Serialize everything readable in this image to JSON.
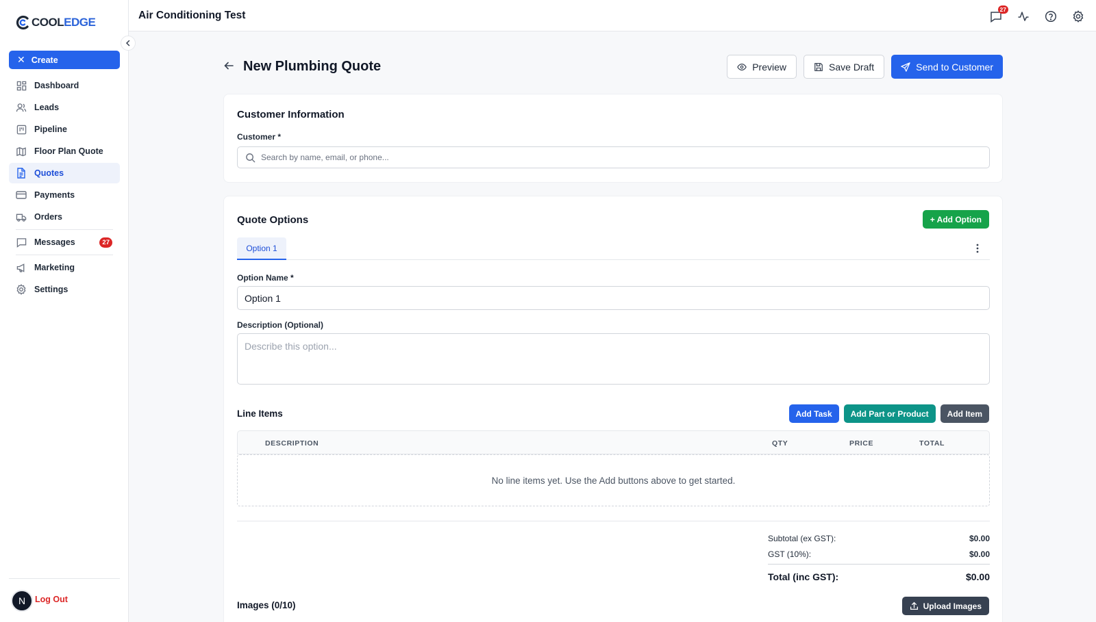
{
  "brand": {
    "name_part1": "COOL",
    "name_part2": "EDGE",
    "accent": "#2563eb"
  },
  "topbar": {
    "title": "Air Conditioning Test",
    "messages_badge": "27",
    "icons": [
      "chat-icon",
      "activity-icon",
      "help-icon",
      "gear-icon"
    ]
  },
  "sidebar": {
    "create_label": "Create",
    "items": [
      {
        "label": "Dashboard",
        "icon": "grid-icon"
      },
      {
        "label": "Leads",
        "icon": "users-icon"
      },
      {
        "label": "Pipeline",
        "icon": "kanban-icon"
      },
      {
        "label": "Floor Plan Quote",
        "icon": "map-icon"
      },
      {
        "label": "Quotes",
        "icon": "file-icon",
        "active": true
      },
      {
        "label": "Payments",
        "icon": "card-icon"
      },
      {
        "label": "Orders",
        "icon": "truck-icon"
      },
      {
        "label": "Messages",
        "icon": "message-icon",
        "badge": "27"
      },
      {
        "label": "Marketing",
        "icon": "megaphone-icon"
      },
      {
        "label": "Settings",
        "icon": "settings-icon"
      }
    ],
    "avatar_initial": "N",
    "logout_label": "Log Out"
  },
  "page": {
    "title": "New Plumbing Quote",
    "preview_label": "Preview",
    "save_draft_label": "Save Draft",
    "send_label": "Send to Customer"
  },
  "customer": {
    "section_title": "Customer Information",
    "field_label": "Customer *",
    "search_placeholder": "Search by name, email, or phone..."
  },
  "options": {
    "section_title": "Quote Options",
    "add_option_label": "+ Add Option",
    "tabs": [
      {
        "label": "Option 1"
      }
    ],
    "option_name_label": "Option Name",
    "option_name_required": "*",
    "option_name_value": "Option 1",
    "description_label": "Description (Optional)",
    "description_placeholder": "Describe this option..."
  },
  "line_items": {
    "title": "Line Items",
    "add_task_label": "Add Task",
    "add_part_label": "Add Part or Product",
    "add_item_label": "Add Item",
    "columns": [
      "DESCRIPTION",
      "QTY",
      "PRICE",
      "TOTAL"
    ],
    "empty_message": "No line items yet. Use the Add buttons above to get started."
  },
  "totals": {
    "subtotal_label": "Subtotal (ex GST):",
    "subtotal_value": "$0.00",
    "gst_label": "GST (10%):",
    "gst_value": "$0.00",
    "total_label": "Total (inc GST):",
    "total_value": "$0.00"
  },
  "images": {
    "title": "Images (0/10)",
    "upload_label": "Upload Images"
  }
}
